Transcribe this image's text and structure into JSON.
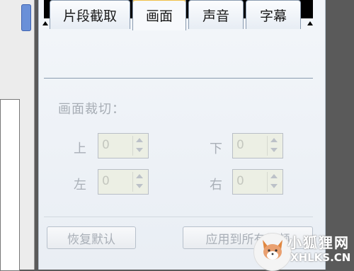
{
  "tabs": [
    {
      "label": "片段截取",
      "active": false
    },
    {
      "label": "画面",
      "active": true
    },
    {
      "label": "声音",
      "active": false
    },
    {
      "label": "字幕",
      "active": false
    }
  ],
  "section_title": "画面裁切：",
  "fields": {
    "top": {
      "label": "上",
      "value": "0"
    },
    "bottom": {
      "label": "下",
      "value": "0"
    },
    "left": {
      "label": "左",
      "value": "0"
    },
    "right": {
      "label": "右",
      "value": "0"
    }
  },
  "buttons": {
    "restore_default": "恢复默认",
    "apply_all": "应用到所有视频"
  },
  "watermark": {
    "line1": "小狐狸网",
    "line2": "XHLKS.CN"
  },
  "colors": {
    "active_tab_accent": "#f0c048",
    "disabled_text": "#a9afb7",
    "panel_bg": "#eef2f7"
  }
}
